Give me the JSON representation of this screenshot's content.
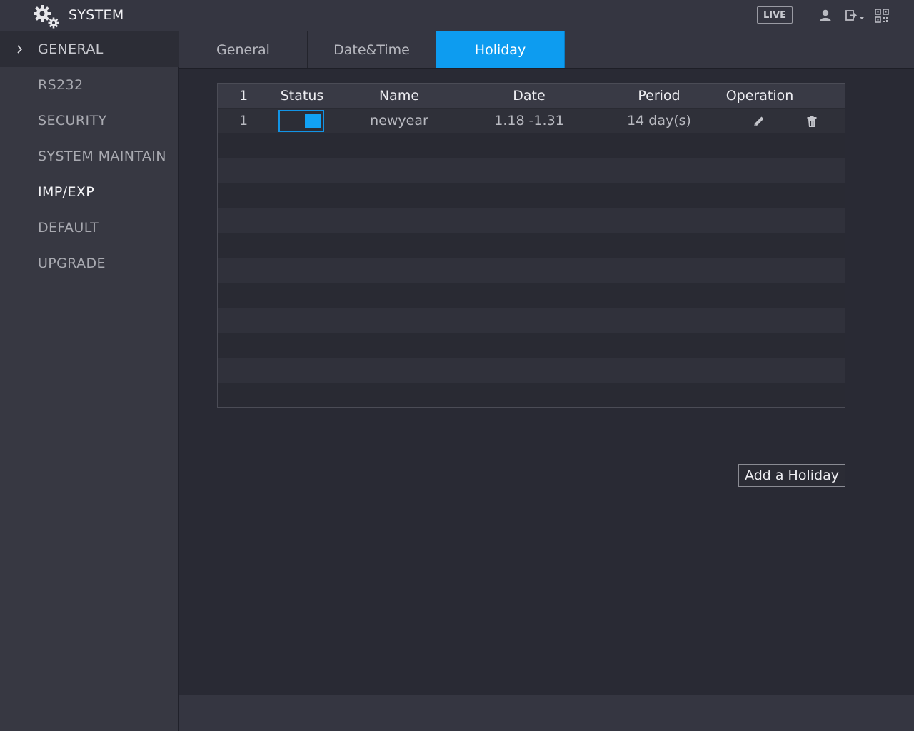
{
  "header": {
    "title": "SYSTEM",
    "app_icon": "gears-icon",
    "live_label": "LIVE",
    "icons": [
      "user-icon",
      "logout-icon",
      "qr-code-icon"
    ]
  },
  "sidebar": {
    "items": [
      {
        "label": "GENERAL",
        "active": true
      },
      {
        "label": "RS232"
      },
      {
        "label": "SECURITY"
      },
      {
        "label": "SYSTEM MAINTAIN"
      },
      {
        "label": "IMP/EXP"
      },
      {
        "label": "DEFAULT"
      },
      {
        "label": "UPGRADE"
      }
    ]
  },
  "tabs": [
    {
      "label": "General"
    },
    {
      "label": "Date&Time"
    },
    {
      "label": "Holiday",
      "active": true
    }
  ],
  "table": {
    "headers": [
      "1",
      "Status",
      "Name",
      "Date",
      "Period",
      "Operation"
    ],
    "rows": [
      {
        "index": "1",
        "status_enabled": true,
        "name": "newyear",
        "date": "1.18 -1.31",
        "period": "14 day(s)",
        "operations": [
          "edit-icon",
          "delete-icon"
        ]
      }
    ]
  },
  "actions": {
    "add_holiday_label": "Add a Holiday"
  },
  "colors": {
    "accent": "#0d9cf0",
    "background": "#292a34",
    "panel": "#353641"
  }
}
